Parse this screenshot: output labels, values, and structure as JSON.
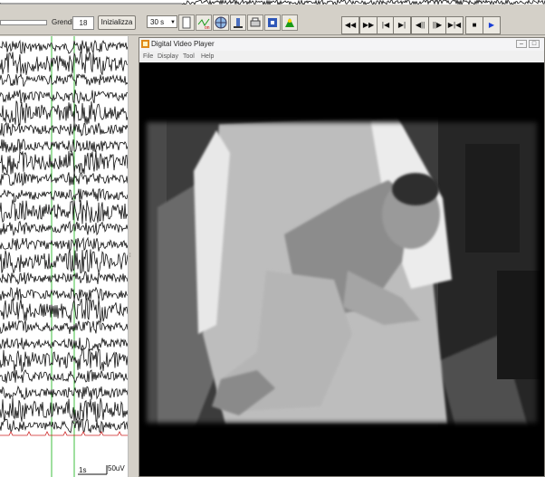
{
  "toolbar": {
    "grendi_label": "Grendi",
    "grendi_value": "18",
    "initialize_label": "Inizializza",
    "timebase_value": "30 s"
  },
  "media_controls": {
    "rewind": "◀◀",
    "fast_forward": "▶▶",
    "to_start": "|◀",
    "to_end": "▶|",
    "step_back": "◀||",
    "step_forward": "||▶",
    "split": "▶|◀",
    "stop": "■",
    "play": "▶"
  },
  "eeg": {
    "time_scale": "1s",
    "amplitude_scale": "50uV"
  },
  "video_player": {
    "title": "Digital Video Player",
    "menu": [
      "File",
      "Display",
      "Tool",
      "Help"
    ]
  },
  "colors": {
    "toolbar_bg": "#d4d0c8",
    "video_bg": "#000000",
    "play_blue": "#1a3fd6",
    "eeg_trace": "#111111",
    "marker_green": "#3fbf3f",
    "marker_red": "#cc2222"
  }
}
